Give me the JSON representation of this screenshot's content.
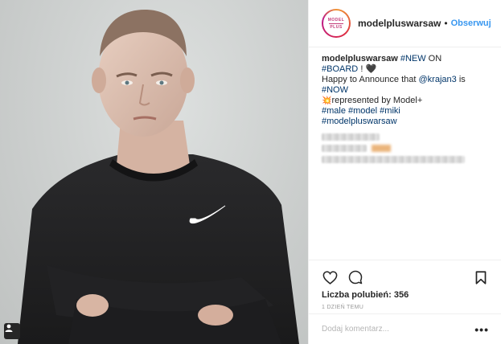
{
  "post": {
    "username": "modelpluswarsaw",
    "follow_label": "Obserwuj",
    "avatar_text_top": "MODEL",
    "avatar_text_bottom": "PLUS",
    "caption": {
      "username": "modelpluswarsaw",
      "tag_new": "#NEW",
      "word_on": "ON",
      "tag_board": "#BOARD",
      "bang": "!",
      "heart": "🖤",
      "line2_text": "Happy to Announce that",
      "mention": "@krajan3",
      "word_is": "is",
      "tag_now": "#NOW",
      "boom": "💥",
      "line3_text": "represented by Model+",
      "hashtags": [
        "#male",
        "#model",
        "#miki",
        "#modelpluswarsaw"
      ]
    },
    "likes_label": "Liczba polubień: 356",
    "time_label": "1 DZIEŃ TEMU",
    "comment_placeholder": "Dodaj komentarz...",
    "more_label": "•••"
  },
  "icons": {
    "like": "heart-outline-icon",
    "comment": "comment-bubble-icon",
    "save": "bookmark-icon",
    "tag": "user-tag-icon",
    "logo": "nike-swoosh"
  },
  "colors": {
    "link_blue": "#3897f0",
    "hashtag": "#003569",
    "text": "#262626",
    "muted": "#999999"
  }
}
